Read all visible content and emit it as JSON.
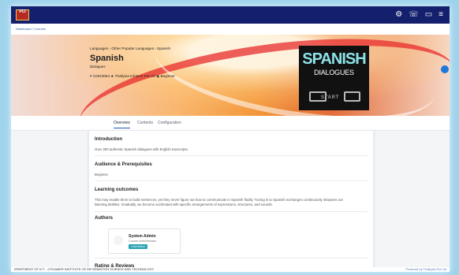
{
  "header": {
    "logo_text": "PCI",
    "actions": [
      {
        "icon": "gear-icon",
        "label": "⚙"
      },
      {
        "icon": "phone-icon",
        "label": "☏"
      },
      {
        "icon": "monitor-icon",
        "label": "▭"
      },
      {
        "icon": "menu-icon",
        "label": "≡"
      }
    ]
  },
  "breadcrumb": {
    "text": "Dashboard / Courses"
  },
  "course": {
    "crumbs": "Languages › Other Popular Languages › Spanish",
    "title": "Spanish",
    "subtitle": "Dialogues",
    "meta": "# C0010064  ★ Thallyxia Infotech Pvt Ltd  ◉ Beginner"
  },
  "poster": {
    "title": "SPANISH",
    "subtitle": "DIALOGUES",
    "start": "START"
  },
  "tabs": [
    "Overview",
    "Contents",
    "Configuration"
  ],
  "sections": {
    "introduction": {
      "title": "Introduction",
      "text": "Over 200 authentic Spanish dialogues with English transcripts."
    },
    "audience": {
      "title": "Audience & Prerequisites",
      "text": "Beginner"
    },
    "outcomes": {
      "title": "Learning outcomes",
      "text": "This may enable them to build sentences, yet they never figure out how to communicate in Spanish fluidly. Tuning in to Spanish exchanges continuously sharpens our listening abilities. Gradually, we become acclimated with specific arrangements of expressions, structures, and sounds."
    },
    "authors": {
      "title": "Authors",
      "name": "System Admin",
      "role": "Course Administrator",
      "badge": "Lead Author"
    },
    "rating": {
      "title": "Rating & Reviews"
    }
  },
  "footer": {
    "left": "EPARTMENT OF ICT - J.P.DAMER INSTITUTE OF INFORMATION SCIENCE AND TECHNOLOGY",
    "right": "Powered by Thallyxia Pvt Ltd"
  }
}
